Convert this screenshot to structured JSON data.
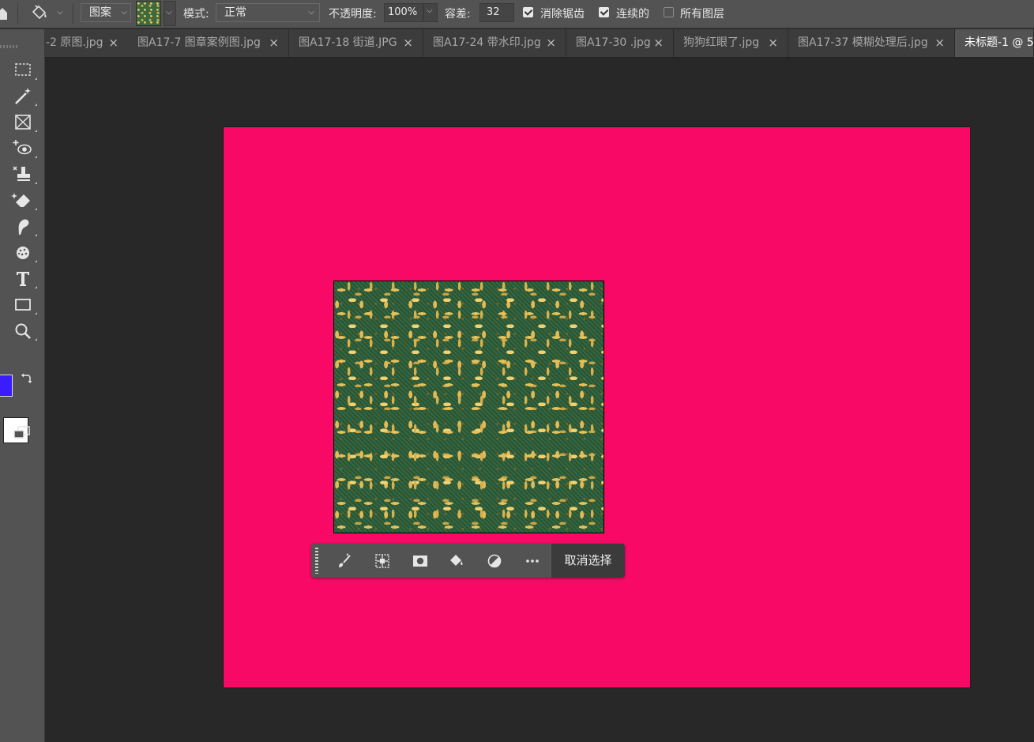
{
  "options_bar": {
    "fill_source": "图案",
    "mode_label": "模式:",
    "mode_value": "正常",
    "opacity_label": "不透明度:",
    "opacity_value": "100%",
    "tolerance_label": "容差:",
    "tolerance_value": "32",
    "antialias_label": "消除锯齿",
    "antialias_checked": true,
    "contiguous_label": "连续的",
    "contiguous_checked": true,
    "all_layers_label": "所有图层",
    "all_layers_checked": false
  },
  "tabs": [
    {
      "label": "-2 原图.jpg",
      "active": false
    },
    {
      "label": "图A17-7 图章案例图.jpg",
      "active": false
    },
    {
      "label": "图A17-18 街道.JPG",
      "active": false
    },
    {
      "label": "图A17-24 带水印.jpg",
      "active": false
    },
    {
      "label": "图A17-30 .jpg",
      "active": false
    },
    {
      "label": "狗狗红眼了.jpg",
      "active": false
    },
    {
      "label": "图A17-37 模糊处理后.jpg",
      "active": false
    },
    {
      "label": "未标题-1 @ 5",
      "active": true
    }
  ],
  "tools": [
    "marquee-tool",
    "magic-wand-tool",
    "frame-tool",
    "red-eye-tool",
    "clone-stamp-tool",
    "eraser-tool",
    "smudge-tool",
    "sponge-tool",
    "type-tool",
    "rectangle-tool",
    "zoom-tool"
  ],
  "colors": {
    "foreground": "#3a1cff",
    "background": "#ffffff",
    "canvas": "#f80966",
    "pasteboard": "#282828"
  },
  "context_bar": {
    "deselect_label": "取消选择",
    "buttons": [
      "brush-icon",
      "transform-selection-icon",
      "mask-icon",
      "paint-bucket-icon",
      "adjustment-icon",
      "more-icon"
    ]
  }
}
